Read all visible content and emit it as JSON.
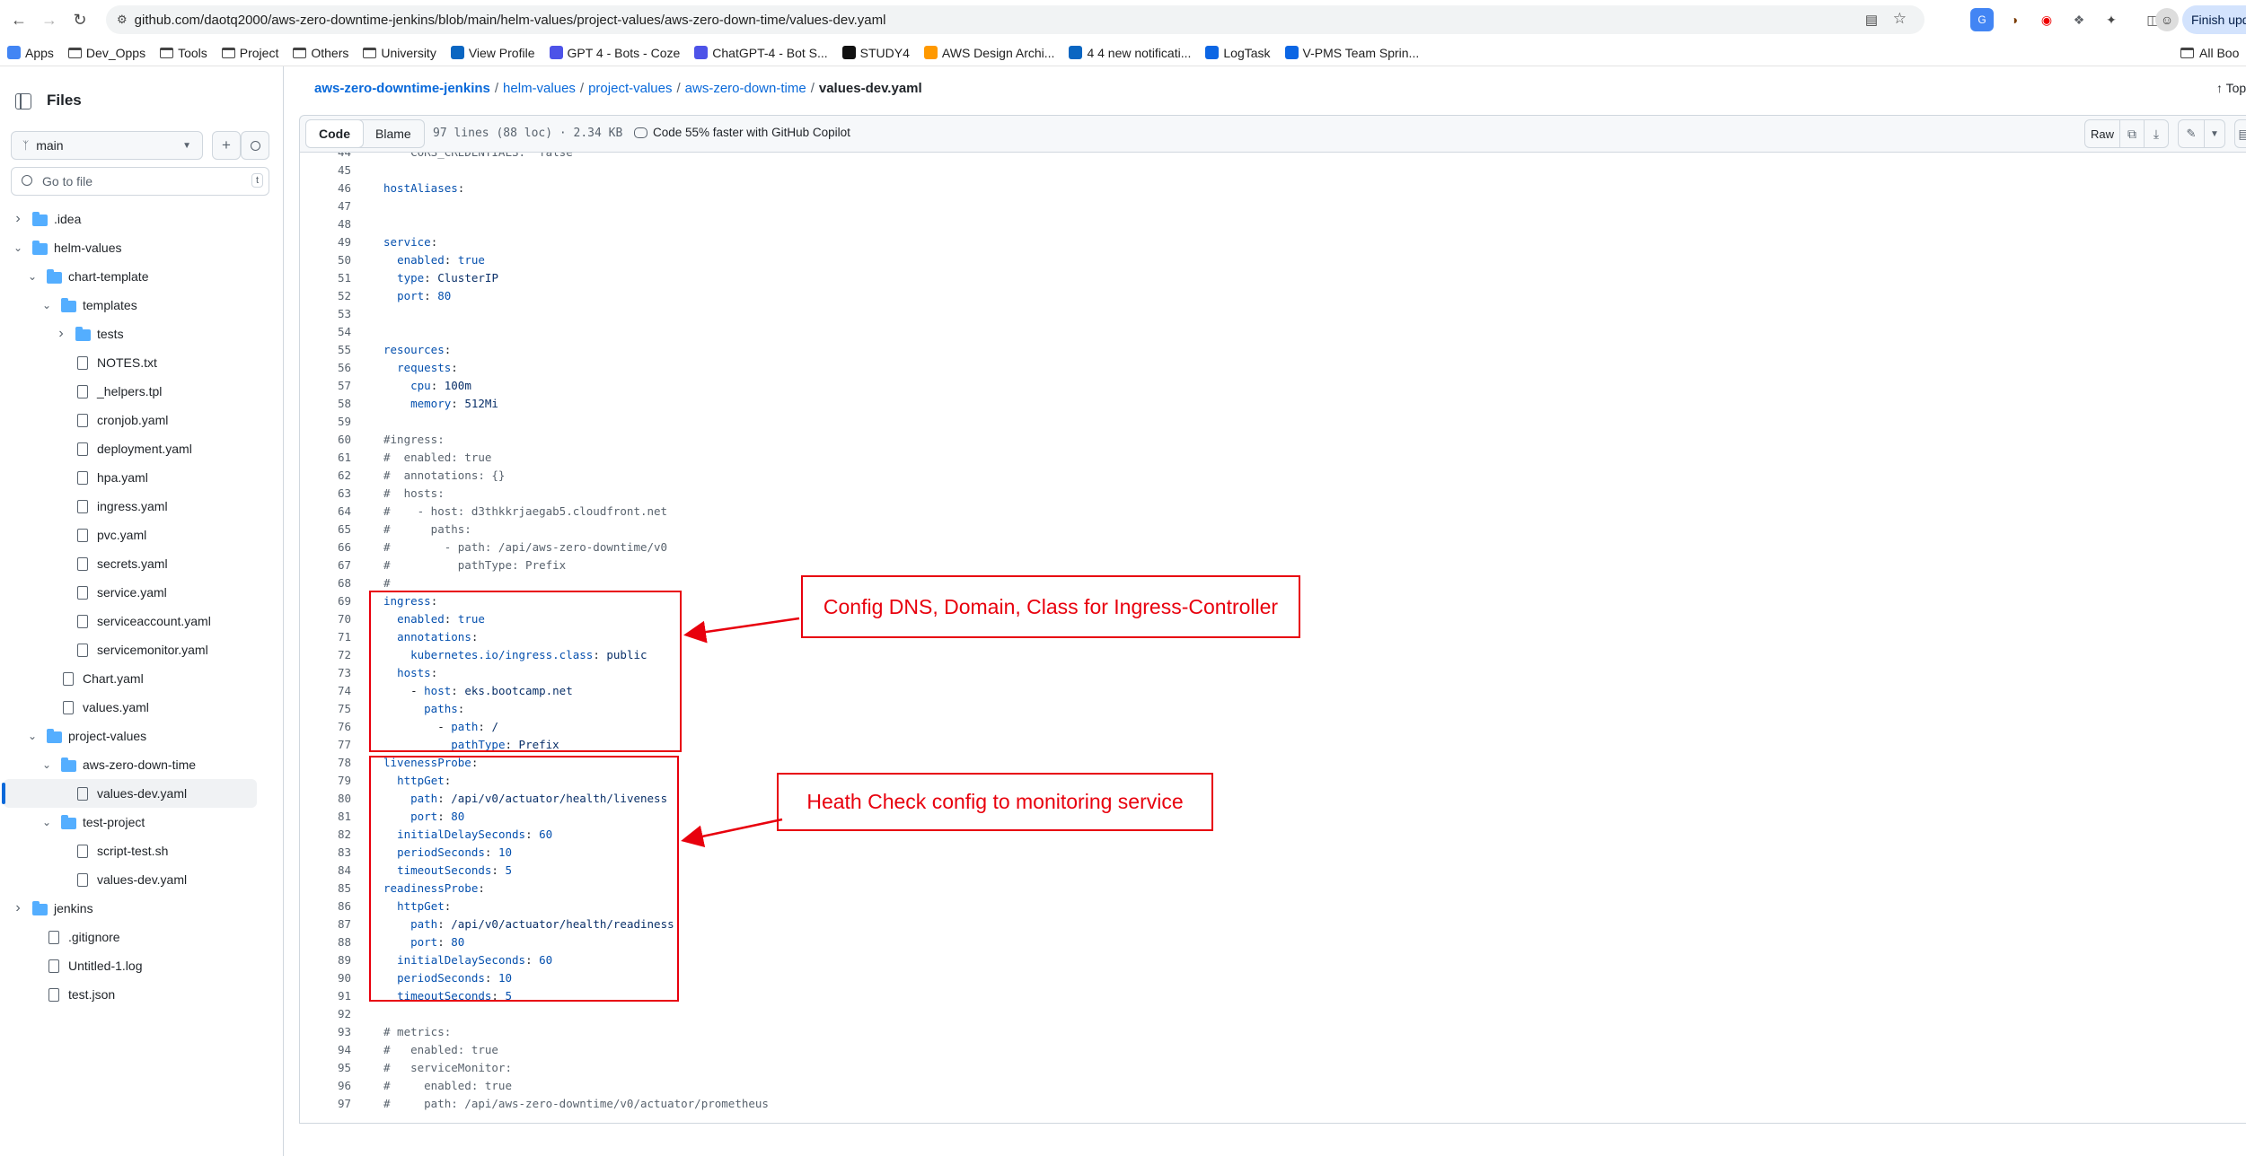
{
  "browser": {
    "url": "github.com/daotq2000/aws-zero-downtime-jenkins/blob/main/helm-values/project-values/aws-zero-down-time/values-dev.yaml",
    "finish_update_label": "Finish upd",
    "bookmarks": [
      {
        "label": "Apps",
        "icon": "apps-grid-icon"
      },
      {
        "label": "Dev_Opps",
        "icon": "folder-icon"
      },
      {
        "label": "Tools",
        "icon": "folder-icon"
      },
      {
        "label": "Project",
        "icon": "folder-icon"
      },
      {
        "label": "Others",
        "icon": "folder-icon"
      },
      {
        "label": "University",
        "icon": "folder-icon"
      },
      {
        "label": "View Profile",
        "icon": "linkedin-icon"
      },
      {
        "label": "GPT 4 - Bots - Coze",
        "icon": "coze-icon"
      },
      {
        "label": "ChatGPT-4 - Bot S...",
        "icon": "coze-icon"
      },
      {
        "label": "STUDY4",
        "icon": "study4-icon"
      },
      {
        "label": "AWS Design Archi...",
        "icon": "aws-icon"
      },
      {
        "label": "4 4 new notificati...",
        "icon": "linkedin-icon"
      },
      {
        "label": "LogTask",
        "icon": "jira-icon"
      },
      {
        "label": "V-PMS Team Sprin...",
        "icon": "jira-icon"
      }
    ],
    "all_bookmarks_label": "All Boo"
  },
  "sidebar": {
    "title": "Files",
    "branch": "main",
    "goto_placeholder": "Go to file",
    "goto_shortcut": "t",
    "tree": [
      {
        "label": ".idea",
        "type": "folder",
        "depth": 0,
        "expanded": false
      },
      {
        "label": "helm-values",
        "type": "folder",
        "depth": 0,
        "expanded": true
      },
      {
        "label": "chart-template",
        "type": "folder",
        "depth": 1,
        "expanded": true
      },
      {
        "label": "templates",
        "type": "folder",
        "depth": 2,
        "expanded": true
      },
      {
        "label": "tests",
        "type": "folder",
        "depth": 3,
        "expanded": false
      },
      {
        "label": "NOTES.txt",
        "type": "file",
        "depth": 3
      },
      {
        "label": "_helpers.tpl",
        "type": "file",
        "depth": 3
      },
      {
        "label": "cronjob.yaml",
        "type": "file",
        "depth": 3
      },
      {
        "label": "deployment.yaml",
        "type": "file",
        "depth": 3
      },
      {
        "label": "hpa.yaml",
        "type": "file",
        "depth": 3
      },
      {
        "label": "ingress.yaml",
        "type": "file",
        "depth": 3
      },
      {
        "label": "pvc.yaml",
        "type": "file",
        "depth": 3
      },
      {
        "label": "secrets.yaml",
        "type": "file",
        "depth": 3
      },
      {
        "label": "service.yaml",
        "type": "file",
        "depth": 3
      },
      {
        "label": "serviceaccount.yaml",
        "type": "file",
        "depth": 3
      },
      {
        "label": "servicemonitor.yaml",
        "type": "file",
        "depth": 3
      },
      {
        "label": "Chart.yaml",
        "type": "file",
        "depth": 2
      },
      {
        "label": "values.yaml",
        "type": "file",
        "depth": 2
      },
      {
        "label": "project-values",
        "type": "folder",
        "depth": 1,
        "expanded": true
      },
      {
        "label": "aws-zero-down-time",
        "type": "folder",
        "depth": 2,
        "expanded": true
      },
      {
        "label": "values-dev.yaml",
        "type": "file",
        "depth": 3,
        "selected": true
      },
      {
        "label": "test-project",
        "type": "folder",
        "depth": 2,
        "expanded": true
      },
      {
        "label": "script-test.sh",
        "type": "file",
        "depth": 3
      },
      {
        "label": "values-dev.yaml",
        "type": "file",
        "depth": 3
      },
      {
        "label": "jenkins",
        "type": "folder",
        "depth": 0,
        "expanded": false
      },
      {
        "label": ".gitignore",
        "type": "file",
        "depth": 1
      },
      {
        "label": "Untitled-1.log",
        "type": "file",
        "depth": 1
      },
      {
        "label": "test.json",
        "type": "file",
        "depth": 1
      }
    ]
  },
  "breadcrumb": {
    "repo": "aws-zero-downtime-jenkins",
    "dir1": "helm-values",
    "dir2": "project-values",
    "dir3": "aws-zero-down-time",
    "file": "values-dev.yaml",
    "separator": "/",
    "top_label": "Top"
  },
  "file_header": {
    "code_tab": "Code",
    "blame_tab": "Blame",
    "meta": "97 lines (88 loc) · 2.34 KB",
    "copilot": "Code 55% faster with GitHub Copilot",
    "raw_label": "Raw"
  },
  "code": [
    {
      "n": "44",
      "parts": [
        [
          "c",
          "    CORS_CREDENTIALS: \"false\""
        ]
      ]
    },
    {
      "n": "45",
      "parts": []
    },
    {
      "n": "46",
      "parts": [
        [
          "k",
          "hostAliases"
        ],
        [
          "p",
          ":"
        ]
      ]
    },
    {
      "n": "47",
      "parts": []
    },
    {
      "n": "48",
      "parts": []
    },
    {
      "n": "49",
      "parts": [
        [
          "k",
          "service"
        ],
        [
          "p",
          ":"
        ]
      ]
    },
    {
      "n": "50",
      "parts": [
        [
          "p",
          "  "
        ],
        [
          "k",
          "enabled"
        ],
        [
          "p",
          ": "
        ],
        [
          "n",
          "true"
        ]
      ]
    },
    {
      "n": "51",
      "parts": [
        [
          "p",
          "  "
        ],
        [
          "k",
          "type"
        ],
        [
          "p",
          ": "
        ],
        [
          "s",
          "ClusterIP"
        ]
      ]
    },
    {
      "n": "52",
      "parts": [
        [
          "p",
          "  "
        ],
        [
          "k",
          "port"
        ],
        [
          "p",
          ": "
        ],
        [
          "n",
          "80"
        ]
      ]
    },
    {
      "n": "53",
      "parts": []
    },
    {
      "n": "54",
      "parts": []
    },
    {
      "n": "55",
      "parts": [
        [
          "k",
          "resources"
        ],
        [
          "p",
          ":"
        ]
      ]
    },
    {
      "n": "56",
      "parts": [
        [
          "p",
          "  "
        ],
        [
          "k",
          "requests"
        ],
        [
          "p",
          ":"
        ]
      ]
    },
    {
      "n": "57",
      "parts": [
        [
          "p",
          "    "
        ],
        [
          "k",
          "cpu"
        ],
        [
          "p",
          ": "
        ],
        [
          "s",
          "100m"
        ]
      ]
    },
    {
      "n": "58",
      "parts": [
        [
          "p",
          "    "
        ],
        [
          "k",
          "memory"
        ],
        [
          "p",
          ": "
        ],
        [
          "s",
          "512Mi"
        ]
      ]
    },
    {
      "n": "59",
      "parts": []
    },
    {
      "n": "60",
      "parts": [
        [
          "c",
          "#ingress:"
        ]
      ]
    },
    {
      "n": "61",
      "parts": [
        [
          "c",
          "#  enabled: true"
        ]
      ]
    },
    {
      "n": "62",
      "parts": [
        [
          "c",
          "#  annotations: {}"
        ]
      ]
    },
    {
      "n": "63",
      "parts": [
        [
          "c",
          "#  hosts:"
        ]
      ]
    },
    {
      "n": "64",
      "parts": [
        [
          "c",
          "#    - host: d3thkkrjaegab5.cloudfront.net"
        ]
      ]
    },
    {
      "n": "65",
      "parts": [
        [
          "c",
          "#      paths:"
        ]
      ]
    },
    {
      "n": "66",
      "parts": [
        [
          "c",
          "#        - path: /api/aws-zero-downtime/v0"
        ]
      ]
    },
    {
      "n": "67",
      "parts": [
        [
          "c",
          "#          pathType: Prefix"
        ]
      ]
    },
    {
      "n": "68",
      "parts": [
        [
          "c",
          "#"
        ]
      ]
    },
    {
      "n": "69",
      "parts": [
        [
          "k",
          "ingress"
        ],
        [
          "p",
          ":"
        ]
      ]
    },
    {
      "n": "70",
      "parts": [
        [
          "p",
          "  "
        ],
        [
          "k",
          "enabled"
        ],
        [
          "p",
          ": "
        ],
        [
          "n",
          "true"
        ]
      ]
    },
    {
      "n": "71",
      "parts": [
        [
          "p",
          "  "
        ],
        [
          "k",
          "annotations"
        ],
        [
          "p",
          ":"
        ]
      ]
    },
    {
      "n": "72",
      "parts": [
        [
          "p",
          "    "
        ],
        [
          "k",
          "kubernetes.io/ingress.class"
        ],
        [
          "p",
          ": "
        ],
        [
          "s",
          "public"
        ]
      ]
    },
    {
      "n": "73",
      "parts": [
        [
          "p",
          "  "
        ],
        [
          "k",
          "hosts"
        ],
        [
          "p",
          ":"
        ]
      ]
    },
    {
      "n": "74",
      "parts": [
        [
          "p",
          "    - "
        ],
        [
          "k",
          "host"
        ],
        [
          "p",
          ": "
        ],
        [
          "s",
          "eks.bootcamp.net"
        ]
      ]
    },
    {
      "n": "75",
      "parts": [
        [
          "p",
          "      "
        ],
        [
          "k",
          "paths"
        ],
        [
          "p",
          ":"
        ]
      ]
    },
    {
      "n": "76",
      "parts": [
        [
          "p",
          "        - "
        ],
        [
          "k",
          "path"
        ],
        [
          "p",
          ": "
        ],
        [
          "s",
          "/"
        ]
      ]
    },
    {
      "n": "77",
      "parts": [
        [
          "p",
          "          "
        ],
        [
          "k",
          "pathType"
        ],
        [
          "p",
          ": "
        ],
        [
          "s",
          "Prefix"
        ]
      ]
    },
    {
      "n": "78",
      "parts": [
        [
          "k",
          "livenessProbe"
        ],
        [
          "p",
          ":"
        ]
      ]
    },
    {
      "n": "79",
      "parts": [
        [
          "p",
          "  "
        ],
        [
          "k",
          "httpGet"
        ],
        [
          "p",
          ":"
        ]
      ]
    },
    {
      "n": "80",
      "parts": [
        [
          "p",
          "    "
        ],
        [
          "k",
          "path"
        ],
        [
          "p",
          ": "
        ],
        [
          "s",
          "/api/v0/actuator/health/liveness"
        ]
      ]
    },
    {
      "n": "81",
      "parts": [
        [
          "p",
          "    "
        ],
        [
          "k",
          "port"
        ],
        [
          "p",
          ": "
        ],
        [
          "n",
          "80"
        ]
      ]
    },
    {
      "n": "82",
      "parts": [
        [
          "p",
          "  "
        ],
        [
          "k",
          "initialDelaySeconds"
        ],
        [
          "p",
          ": "
        ],
        [
          "n",
          "60"
        ]
      ]
    },
    {
      "n": "83",
      "parts": [
        [
          "p",
          "  "
        ],
        [
          "k",
          "periodSeconds"
        ],
        [
          "p",
          ": "
        ],
        [
          "n",
          "10"
        ]
      ]
    },
    {
      "n": "84",
      "parts": [
        [
          "p",
          "  "
        ],
        [
          "k",
          "timeoutSeconds"
        ],
        [
          "p",
          ": "
        ],
        [
          "n",
          "5"
        ]
      ]
    },
    {
      "n": "85",
      "parts": [
        [
          "k",
          "readinessProbe"
        ],
        [
          "p",
          ":"
        ]
      ]
    },
    {
      "n": "86",
      "parts": [
        [
          "p",
          "  "
        ],
        [
          "k",
          "httpGet"
        ],
        [
          "p",
          ":"
        ]
      ]
    },
    {
      "n": "87",
      "parts": [
        [
          "p",
          "    "
        ],
        [
          "k",
          "path"
        ],
        [
          "p",
          ": "
        ],
        [
          "s",
          "/api/v0/actuator/health/readiness"
        ]
      ]
    },
    {
      "n": "88",
      "parts": [
        [
          "p",
          "    "
        ],
        [
          "k",
          "port"
        ],
        [
          "p",
          ": "
        ],
        [
          "n",
          "80"
        ]
      ]
    },
    {
      "n": "89",
      "parts": [
        [
          "p",
          "  "
        ],
        [
          "k",
          "initialDelaySeconds"
        ],
        [
          "p",
          ": "
        ],
        [
          "n",
          "60"
        ]
      ]
    },
    {
      "n": "90",
      "parts": [
        [
          "p",
          "  "
        ],
        [
          "k",
          "periodSeconds"
        ],
        [
          "p",
          ": "
        ],
        [
          "n",
          "10"
        ]
      ]
    },
    {
      "n": "91",
      "parts": [
        [
          "p",
          "  "
        ],
        [
          "k",
          "timeoutSeconds"
        ],
        [
          "p",
          ": "
        ],
        [
          "n",
          "5"
        ]
      ]
    },
    {
      "n": "92",
      "parts": []
    },
    {
      "n": "93",
      "parts": [
        [
          "c",
          "# metrics:"
        ]
      ]
    },
    {
      "n": "94",
      "parts": [
        [
          "c",
          "#   enabled: true"
        ]
      ]
    },
    {
      "n": "95",
      "parts": [
        [
          "c",
          "#   serviceMonitor:"
        ]
      ]
    },
    {
      "n": "96",
      "parts": [
        [
          "c",
          "#     enabled: true"
        ]
      ]
    },
    {
      "n": "97",
      "parts": [
        [
          "c",
          "#     path: /api/aws-zero-downtime/v0/actuator/prometheus"
        ]
      ]
    }
  ],
  "annotations": {
    "ingress_note": "Config DNS, Domain, Class for Ingress-Controller",
    "health_note": "Heath Check config to monitoring service",
    "color": "#e8000d"
  }
}
